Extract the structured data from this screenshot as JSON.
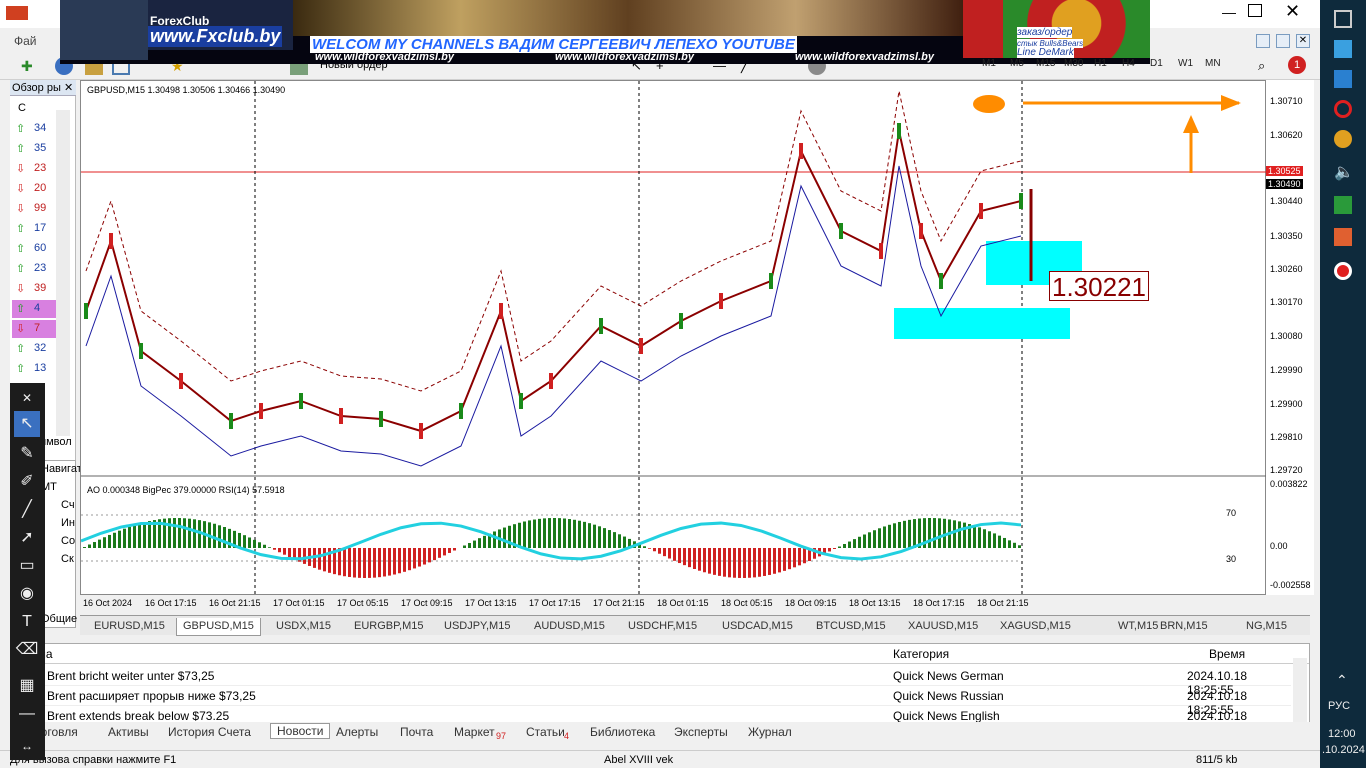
{
  "banner": {
    "brand": "ForexClub",
    "site": "www.Fxclub.by",
    "headline": "WELCOM MY CHANNELS ВАДИМ СЕРГЕЕВИЧ ЛЕПЕХО YOUTUBE",
    "url": "www.wildforexvadzimsl.by",
    "right_lines": [
      "заказ/ордер",
      "стык Bulls&Bears",
      "Line DeMark"
    ]
  },
  "menu": {
    "file_label": "Фай"
  },
  "toolbar": {
    "new_order": "Новый ордер",
    "timeframes": [
      "M1",
      "M5",
      "M15",
      "M30",
      "H1",
      "H4",
      "D1",
      "W1",
      "MN"
    ],
    "alert_count": "1"
  },
  "market_watch": {
    "title": "Обзор ры",
    "col": "С",
    "rows": [
      {
        "v": "34",
        "dir": "up"
      },
      {
        "v": "35",
        "dir": "up"
      },
      {
        "v": "23",
        "dir": "down"
      },
      {
        "v": "20",
        "dir": "down"
      },
      {
        "v": "99",
        "dir": "down"
      },
      {
        "v": "17",
        "dir": "up"
      },
      {
        "v": "60",
        "dir": "up"
      },
      {
        "v": "23",
        "dir": "up"
      },
      {
        "v": "39",
        "dir": "down"
      },
      {
        "v": "4",
        "dir": "up"
      },
      {
        "v": "7",
        "dir": "down"
      },
      {
        "v": "32",
        "dir": "up"
      },
      {
        "v": "13",
        "dir": "up"
      }
    ],
    "tab_label": "Символ"
  },
  "navigator": {
    "title": "Навигатор",
    "items": [
      "МТ",
      "Сч",
      "Ин",
      "Со",
      "Ск"
    ],
    "footer": "Общие"
  },
  "chart": {
    "header": "GBPUSD,M15  1.30498 1.30506 1.30466 1.30490",
    "callout": "1.30221",
    "price_ticks": [
      "1.30710",
      "1.30620",
      "1.30440",
      "1.30350",
      "1.30260",
      "1.30170",
      "1.30080",
      "1.29990",
      "1.29900",
      "1.29810",
      "1.29720"
    ],
    "current_red": "1.30525",
    "current_black": "1.30490",
    "indicator_header": "AO 0.000348  BigPec 379.00000  RSI(14) 57.5918",
    "ind_ticks": [
      "0.003822",
      "70",
      "0.00",
      "30",
      "-0.002558"
    ],
    "time_ticks": [
      "16 Oct 2024",
      "16 Oct 17:15",
      "16 Oct 21:15",
      "17 Oct 01:15",
      "17 Oct 05:15",
      "17 Oct 09:15",
      "17 Oct 13:15",
      "17 Oct 17:15",
      "17 Oct 21:15",
      "18 Oct 01:15",
      "18 Oct 05:15",
      "18 Oct 09:15",
      "18 Oct 13:15",
      "18 Oct 17:15",
      "18 Oct 21:15"
    ]
  },
  "chart_tabs": [
    "EURUSD,M15",
    "GBPUSD,M15",
    "USDX,M15",
    "EURGBP,M15",
    "USDJPY,M15",
    "AUDUSD,M15",
    "USDCHF,M15",
    "USDCAD,M15",
    "BTCUSD,M15",
    "XAUUSD,M15",
    "XAGUSD,M15",
    "WT,M15",
    "BRN,M15",
    "NG,M15"
  ],
  "active_tab": "GBPUSD,M15",
  "news": {
    "headers": {
      "subject": "ема",
      "category": "Категория",
      "time": "Время"
    },
    "rows": [
      {
        "subject": "Brent bricht weiter unter $73,25",
        "category": "Quick News German",
        "time": "2024.10.18 18:25:55"
      },
      {
        "subject": "Brent расширяет прорыв ниже $73,25",
        "category": "Quick News Russian",
        "time": "2024.10.18 18:25:55"
      },
      {
        "subject": "Brent extends break below $73.25",
        "category": "Quick News English",
        "time": "2024.10.18 18:25:55"
      }
    ]
  },
  "bottom_tabs": [
    "орговля",
    "Активы",
    "История Счета",
    "Новости",
    "Алерты",
    "Почта",
    "Маркет",
    "Статьи",
    "Библиотека",
    "Эксперты",
    "Журнал"
  ],
  "bottom_badges": {
    "market": "97",
    "articles": "4"
  },
  "status": {
    "help": "Для вызова справки нажмите F1",
    "profile": "Abel XVIII vek",
    "traffic": "811/5 kb"
  },
  "taskbar": {
    "lang": "РУС",
    "time": "12:00",
    "date": ".10.2024"
  }
}
